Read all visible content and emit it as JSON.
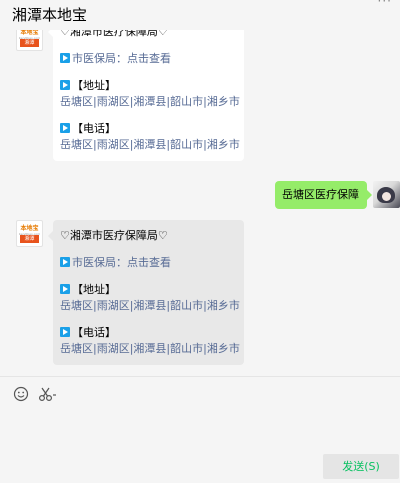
{
  "window": {
    "title": "湘潭本地宝",
    "more_icon": "ellipsis-icon"
  },
  "messages": {
    "first": {
      "lines": [
        "♡湘潭市医疗保障局♡"
      ],
      "link_label": "市医保局：点击查看",
      "address_header": "【地址】",
      "address_value": "岳塘区|雨湖区|湘潭县|韶山市|湘乡市",
      "phone_header": "【电话】",
      "phone_value": "岳塘区|雨湖区|湘潭县|韶山市|湘乡市"
    },
    "user": {
      "text": "岳塘区医疗保障"
    },
    "second": {
      "title": "♡湘潭市医疗保障局♡",
      "link_label": "市医保局：点击查看",
      "address_header": "【地址】",
      "address_value": "岳塘区|雨湖区|湘潭县|韶山市|湘乡市",
      "phone_header": "【电话】",
      "phone_value": "岳塘区|雨湖区|湘潭县|韶山市|湘乡市"
    }
  },
  "bot_avatar": {
    "logo_text": "本地宝",
    "logo_sub": "bendibao.com",
    "logo_band": "湘潭"
  },
  "input": {
    "emoji_icon": "emoji-icon",
    "scissors_icon": "scissors-icon",
    "send_label": "发送(S)"
  },
  "colors": {
    "self_bubble": "#95ec69",
    "link": "#576b95",
    "send_text": "#07c160"
  }
}
